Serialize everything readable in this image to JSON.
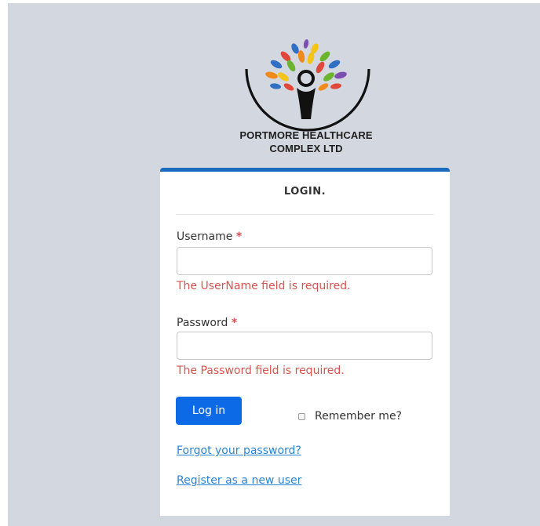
{
  "brand": {
    "name_line1": "PORTMORE HEALTHCARE",
    "name_line2": "COMPLEX LTD",
    "logo_icon": "tree-person-logo-icon",
    "colors": {
      "arc": "#111111",
      "blue": "#2f6fc4",
      "orange": "#f08a1c",
      "yellow": "#f4c419",
      "green": "#6bb42f",
      "purple": "#7d4fb0",
      "red": "#e0483c"
    }
  },
  "login": {
    "title": "LOGIN.",
    "username_label": "Username",
    "password_label": "Password",
    "required_marker": "*",
    "username_value": "",
    "password_value": "",
    "username_error": "The UserName field is required.",
    "password_error": "The Password field is required.",
    "submit_label": "Log in",
    "remember_label": "Remember me?",
    "remember_checked": false,
    "forgot_link": "Forgot your password?",
    "register_link": "Register as a new user"
  },
  "theme": {
    "accent": "#1a6bbd",
    "button": "#0d6ae6",
    "error": "#d9534f",
    "link": "#2a84d6",
    "background": "#d3d7df"
  }
}
